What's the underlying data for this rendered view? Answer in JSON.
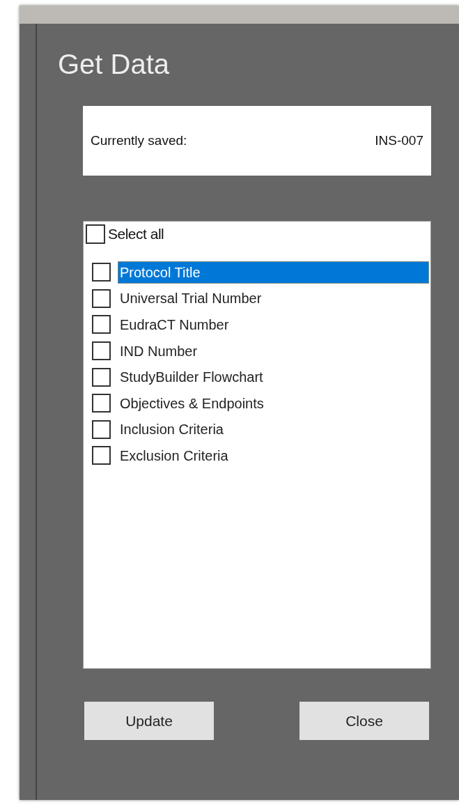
{
  "window": {
    "title": "Get Data"
  },
  "saved": {
    "label": "Currently saved:",
    "value": "INS-007"
  },
  "select_all": {
    "label": "Select all",
    "checked": false
  },
  "items": [
    {
      "label": "Protocol Title",
      "checked": false,
      "selected": true
    },
    {
      "label": "Universal Trial Number",
      "checked": false,
      "selected": false
    },
    {
      "label": "EudraCT Number",
      "checked": false,
      "selected": false
    },
    {
      "label": "IND Number",
      "checked": false,
      "selected": false
    },
    {
      "label": "StudyBuilder Flowchart",
      "checked": false,
      "selected": false
    },
    {
      "label": "Objectives & Endpoints",
      "checked": false,
      "selected": false
    },
    {
      "label": "Inclusion Criteria",
      "checked": false,
      "selected": false
    },
    {
      "label": "Exclusion Criteria",
      "checked": false,
      "selected": false
    }
  ],
  "buttons": [
    "Update",
    "Close"
  ]
}
